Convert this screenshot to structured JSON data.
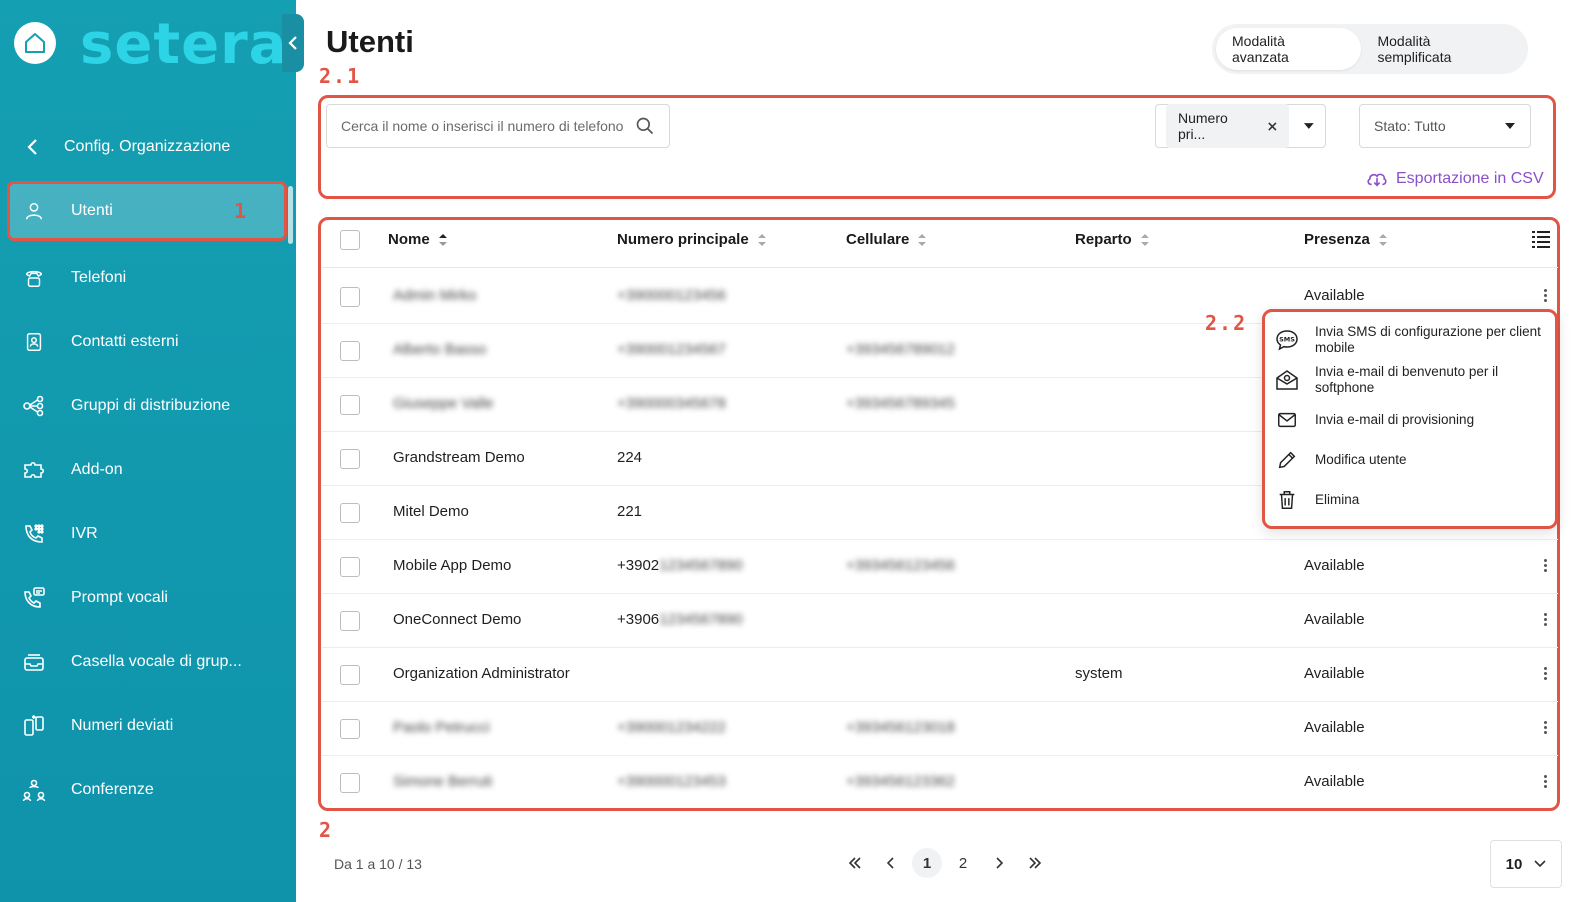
{
  "sidebar": {
    "brand": "setera",
    "back_label": "Config. Organizzazione",
    "items": [
      {
        "label": "Utenti",
        "icon": "user-icon"
      },
      {
        "label": "Telefoni",
        "icon": "phone-icon"
      },
      {
        "label": "Contatti esterni",
        "icon": "contact-card-icon"
      },
      {
        "label": "Gruppi di distribuzione",
        "icon": "distribution-group-icon"
      },
      {
        "label": "Add-on",
        "icon": "puzzle-icon"
      },
      {
        "label": "IVR",
        "icon": "ivr-keypad-icon"
      },
      {
        "label": "Prompt vocali",
        "icon": "voice-prompt-icon"
      },
      {
        "label": "Casella vocale di grup...",
        "icon": "voicemail-inbox-icon"
      },
      {
        "label": "Numeri deviati",
        "icon": "forwarded-numbers-icon"
      },
      {
        "label": "Conferenze",
        "icon": "conference-icon"
      }
    ]
  },
  "annotations": {
    "nav": "1",
    "filters": "2.1",
    "menu": "2.2",
    "table": "2"
  },
  "header": {
    "title": "Utenti",
    "mode_advanced": "Modalità avanzata",
    "mode_simple": "Modalità semplificata"
  },
  "filters": {
    "search_placeholder": "Cerca il nome o inserisci il numero di telefono",
    "number_chip": "Numero pri...",
    "stato": "Stato: Tutto",
    "csv_export": "Esportazione in CSV"
  },
  "table": {
    "columns": [
      "Nome",
      "Numero principale",
      "Cellulare",
      "Reparto",
      "Presenza"
    ],
    "rows": [
      {
        "name": "Admin Mirko",
        "main": "+390000123456",
        "mobile": "",
        "dept": "",
        "presence": "Available",
        "blurred": true
      },
      {
        "name": "Alberto Basso",
        "main": "+390001234567",
        "mobile": "+393456789012",
        "dept": "",
        "presence": "",
        "blurred": true
      },
      {
        "name": "Giuseppe Valle",
        "main": "+390000345678",
        "mobile": "+393456789345",
        "dept": "",
        "presence": "",
        "blurred": true
      },
      {
        "name": "Grandstream Demo",
        "main": "224",
        "mobile": "",
        "dept": "",
        "presence": "",
        "blurred": false
      },
      {
        "name": "Mitel Demo",
        "main": "221",
        "mobile": "",
        "dept": "",
        "presence": "",
        "blurred": false
      },
      {
        "name": "Mobile App Demo",
        "main": "+3902",
        "main_blur": "1234567890",
        "mobile": "+393456123456",
        "dept": "",
        "presence": "Available",
        "blurred": false
      },
      {
        "name": "OneConnect Demo",
        "main": "+3906",
        "main_blur": "1234567890",
        "mobile": "",
        "dept": "",
        "presence": "Available",
        "blurred": false
      },
      {
        "name": "Organization Administrator",
        "main": "",
        "mobile": "",
        "dept": "system",
        "presence": "Available",
        "blurred": false
      },
      {
        "name": "Paolo Petrucci",
        "main": "+390001234222",
        "mobile": "+393456123018",
        "dept": "",
        "presence": "Available",
        "blurred": true
      },
      {
        "name": "Simone Berruti",
        "main": "+390000123453",
        "mobile": "+393456123362",
        "dept": "",
        "presence": "Available",
        "blurred": true
      }
    ]
  },
  "context_menu": [
    {
      "label": "Invia SMS di configurazione per client mobile",
      "icon": "sms-icon"
    },
    {
      "label": "Invia e-mail di benvenuto per il softphone",
      "icon": "open-envelope-icon"
    },
    {
      "label": "Invia e-mail di provisioning",
      "icon": "envelope-icon"
    },
    {
      "label": "Modifica utente",
      "icon": "pencil-icon"
    },
    {
      "label": "Elimina",
      "icon": "trash-icon"
    }
  ],
  "footer": {
    "range": "Da 1 a 10 / 13",
    "pages": [
      "1",
      "2"
    ],
    "current_page": "1",
    "page_size": "10"
  },
  "colors": {
    "sidebar": "#159fb2",
    "brand_text": "#2dd4e6",
    "annotation": "#e25545",
    "link": "#8a4fc9"
  }
}
